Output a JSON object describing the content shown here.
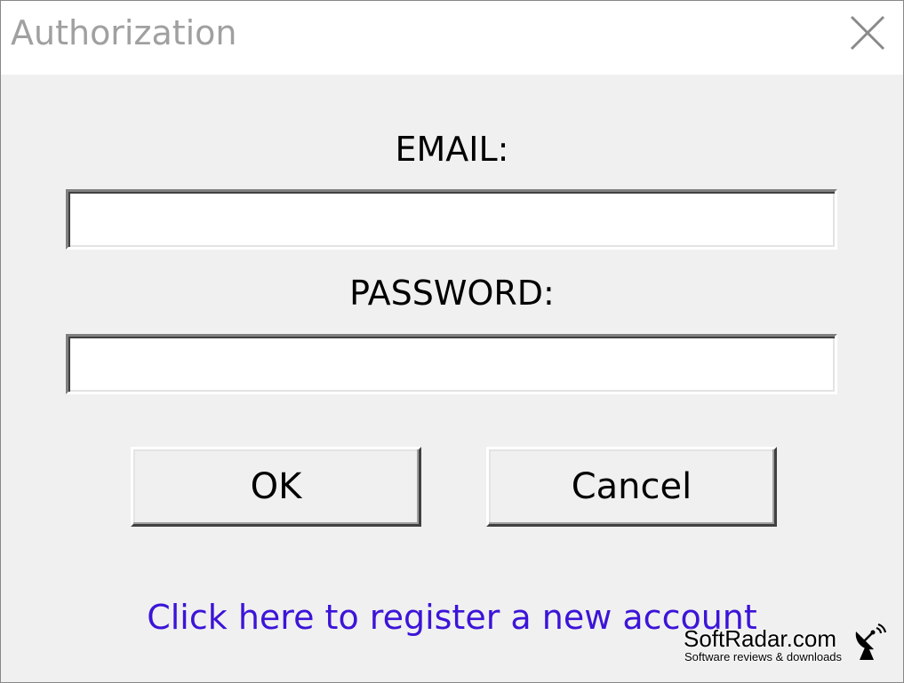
{
  "window": {
    "title": "Authorization",
    "close_icon": "close-icon"
  },
  "form": {
    "email_label": "EMAIL:",
    "email_value": "",
    "password_label": "PASSWORD:",
    "password_value": ""
  },
  "buttons": {
    "ok_label": "OK",
    "cancel_label": "Cancel"
  },
  "register_link": {
    "label": "Click here to register a new account",
    "color": "#3c14d8"
  },
  "watermark": {
    "brand": "SoftRadar.com",
    "tagline": "Software reviews & downloads",
    "icon": "satellite-dish-icon"
  }
}
